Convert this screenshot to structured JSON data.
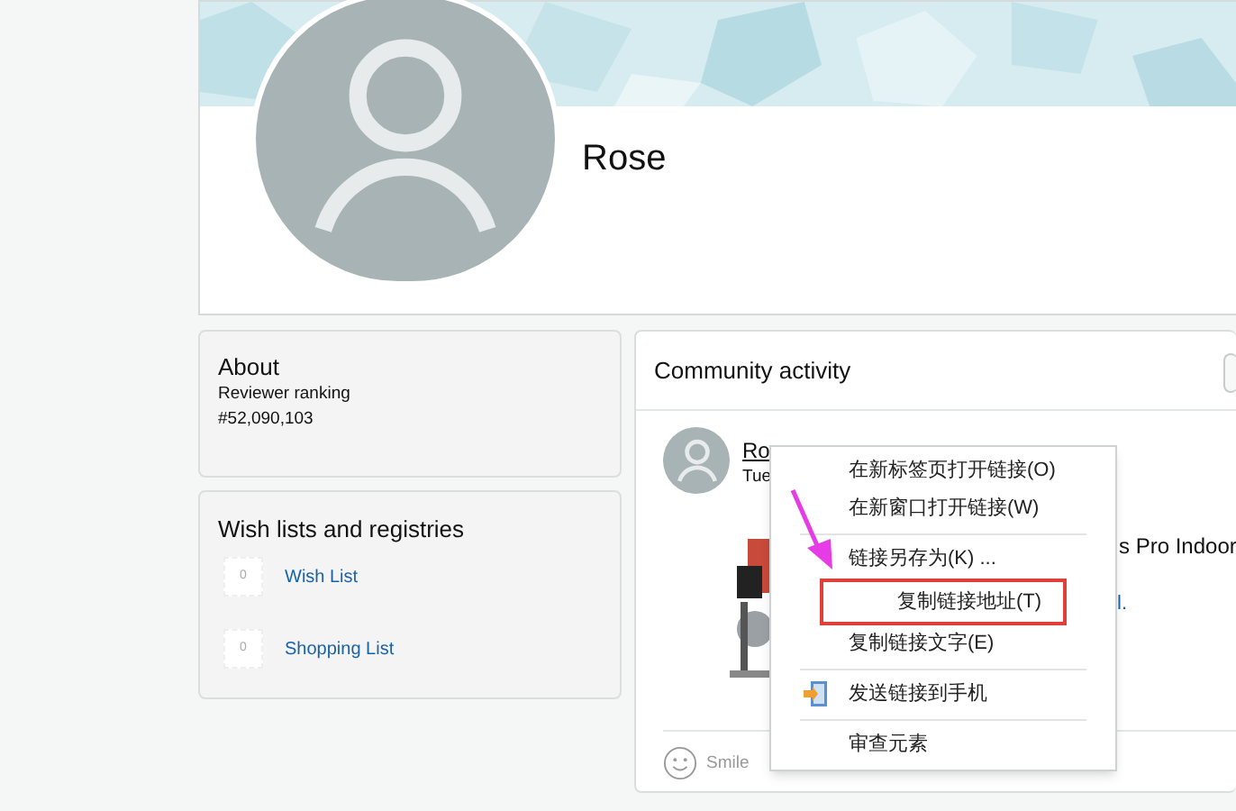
{
  "profile": {
    "name": "Rose"
  },
  "about": {
    "title": "About",
    "label": "Reviewer ranking",
    "value": "#52,090,103"
  },
  "wish_lists": {
    "title": "Wish lists and registries",
    "items": [
      {
        "count": "0",
        "label": "Wish List"
      },
      {
        "count": "0",
        "label": "Shopping List"
      }
    ]
  },
  "community": {
    "title": "Community activity",
    "activity": {
      "author_text": "Ro",
      "date": "Tue",
      "product_text": "s Pro Indoor",
      "link_text": "l.",
      "reaction": "Smile"
    }
  },
  "context_menu": {
    "items": [
      {
        "label": "在新标签页打开链接(O)",
        "divider_before": false,
        "has_icon": false,
        "highlighted": false
      },
      {
        "label": "在新窗口打开链接(W)",
        "divider_before": false,
        "has_icon": false,
        "highlighted": false
      },
      {
        "label": "链接另存为(K) ...",
        "divider_before": true,
        "has_icon": false,
        "highlighted": false
      },
      {
        "label": "复制链接地址(T)",
        "divider_before": false,
        "has_icon": false,
        "highlighted": true
      },
      {
        "label": "复制链接文字(E)",
        "divider_before": false,
        "has_icon": false,
        "highlighted": false
      },
      {
        "label": "发送链接到手机",
        "divider_before": true,
        "has_icon": true,
        "highlighted": false
      },
      {
        "label": "审查元素",
        "divider_before": true,
        "has_icon": false,
        "highlighted": false
      }
    ]
  }
}
